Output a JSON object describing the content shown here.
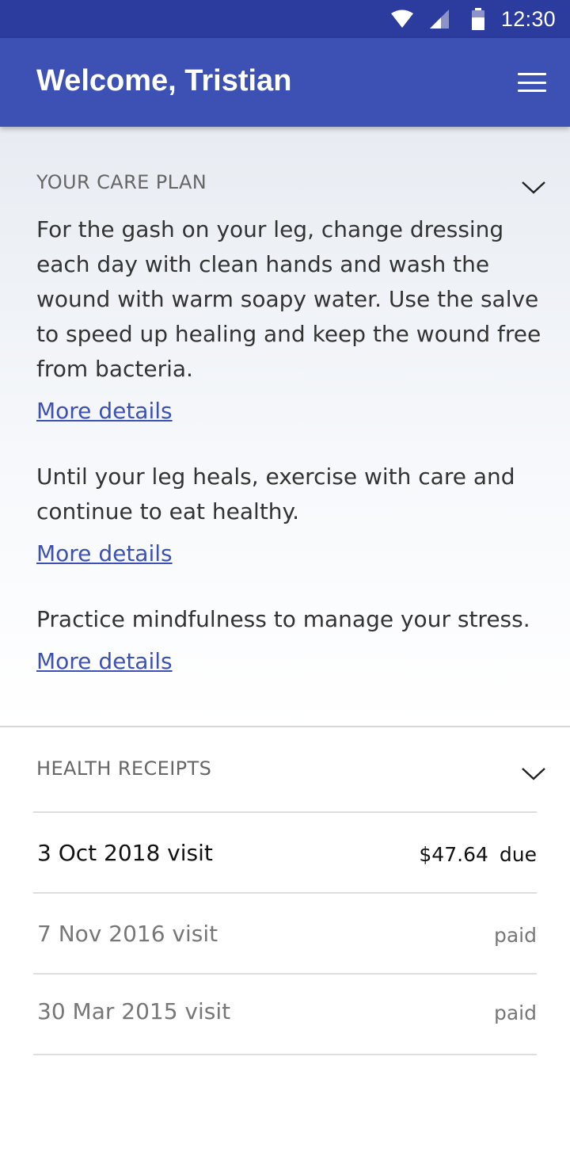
{
  "status_bar": {
    "time": "12:30",
    "icons": [
      "wifi-icon",
      "signal-icon",
      "battery-icon"
    ]
  },
  "header": {
    "title": "Welcome, Tristian",
    "menu_icon": "hamburger-menu-icon"
  },
  "care_plan": {
    "title": "YOUR CARE PLAN",
    "items": [
      {
        "text": "For the gash on your leg, change dressing each day with clean hands and wash the wound with warm soapy water. Use the salve to speed up healing and keep the wound free from bacteria.",
        "link": "More details"
      },
      {
        "text": "Until your leg heals, exercise with care and continue to eat healthy.",
        "link": "More details"
      },
      {
        "text": "Practice mindfulness to manage your stress.",
        "link": "More details"
      }
    ]
  },
  "health_receipts": {
    "title": "HEALTH RECEIPTS",
    "rows": [
      {
        "date": "3 Oct 2018 visit",
        "amount": "$47.64",
        "status": "due"
      },
      {
        "date": "7 Nov 2016 visit",
        "amount": "",
        "status": "paid"
      },
      {
        "date": "30 Mar 2015 visit",
        "amount": "",
        "status": "paid"
      }
    ]
  },
  "colors": {
    "status_bar": "#2c3b9e",
    "app_bar": "#3d51b5",
    "link": "#3d51b5"
  }
}
